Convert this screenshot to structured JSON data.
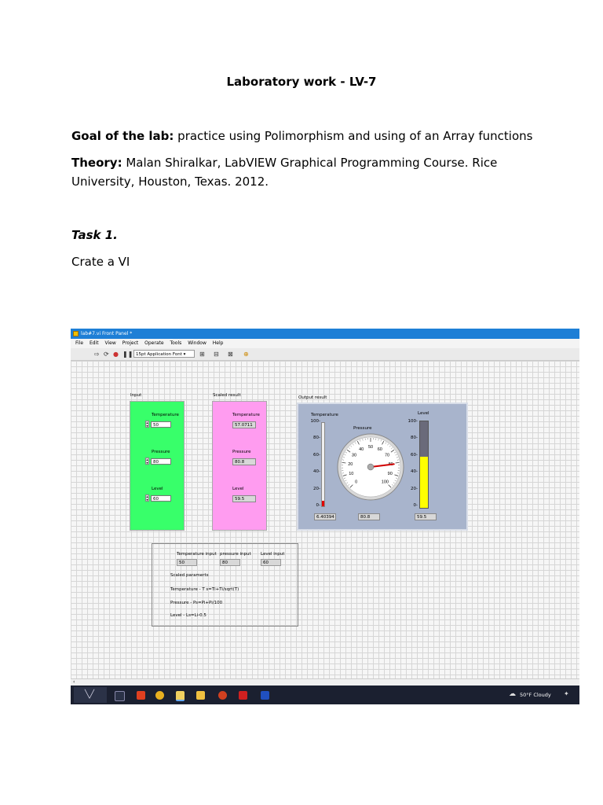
{
  "document": {
    "title": "Laboratory work - LV-7",
    "goal_label": "Goal of the lab:",
    "goal_text": " practice using Polimorphism and using of an Array functions",
    "theory_label": "Theory:",
    "theory_text": " Malan Shiralkar, LabVIEW Graphical Programming Course. Rice University, Houston, Texas. 2012.",
    "task_heading": "Task 1.",
    "task_text": "Crate a VI"
  },
  "window": {
    "title": "lab#7.vi Front Panel *",
    "menu": [
      "File",
      "Edit",
      "View",
      "Project",
      "Operate",
      "Tools",
      "Window",
      "Help"
    ],
    "font_selector": "15pt Application Font",
    "colors": {
      "titlebar": "#1e7fd6",
      "input_panel": "#38ff6a",
      "scaled_panel": "#ff9cf0",
      "output_panel": "#a8b4cc"
    }
  },
  "input": {
    "label": "Input",
    "temperature_label": "Temperature",
    "temperature_value": "50",
    "pressure_label": "Pressure",
    "pressure_value": "80",
    "level_label": "Level",
    "level_value": "60"
  },
  "scaled": {
    "label": "Scaled result",
    "temperature_label": "Temperature",
    "temperature_value": "57.0711",
    "pressure_label": "Pressure",
    "pressure_value": "80.8",
    "level_label": "Level",
    "level_value": "59.5"
  },
  "output": {
    "label": "Output result",
    "temperature_label": "Temperature",
    "pressure_label": "Pressure",
    "level_label": "Level",
    "thermo_ticks": [
      "100-",
      "80-",
      "60-",
      "40-",
      "20-",
      "0-"
    ],
    "level_ticks": [
      "100-",
      "80-",
      "60-",
      "40-",
      "20-",
      "0-"
    ],
    "gauge_ticks": [
      "0",
      "10",
      "20",
      "30",
      "40",
      "50",
      "60",
      "70",
      "80",
      "90",
      "100"
    ],
    "temperature_value": "6.40394",
    "pressure_value": "80.8",
    "level_value": "59.5",
    "thermo_level": 6.4,
    "gauge_level": 80.8,
    "tank_level": 59.5
  },
  "summary": {
    "temp_input_label": "Temperature input",
    "pressure_input_label": "pressure input",
    "level_input_label": "Level input",
    "temp_input_value": "50",
    "pressure_input_value": "80",
    "level_input_value": "60",
    "scaled_heading": "Scaled paramerts",
    "temp_formula": "Temperature -  T s=Ti+Ti/sqrt(T)",
    "pressure_formula": "Pressure  - Ps=Pi+Pi/100",
    "level_formula": "Level  - Ls=Li-0.5"
  },
  "taskbar": {
    "weather": "50°F  Cloudy"
  }
}
